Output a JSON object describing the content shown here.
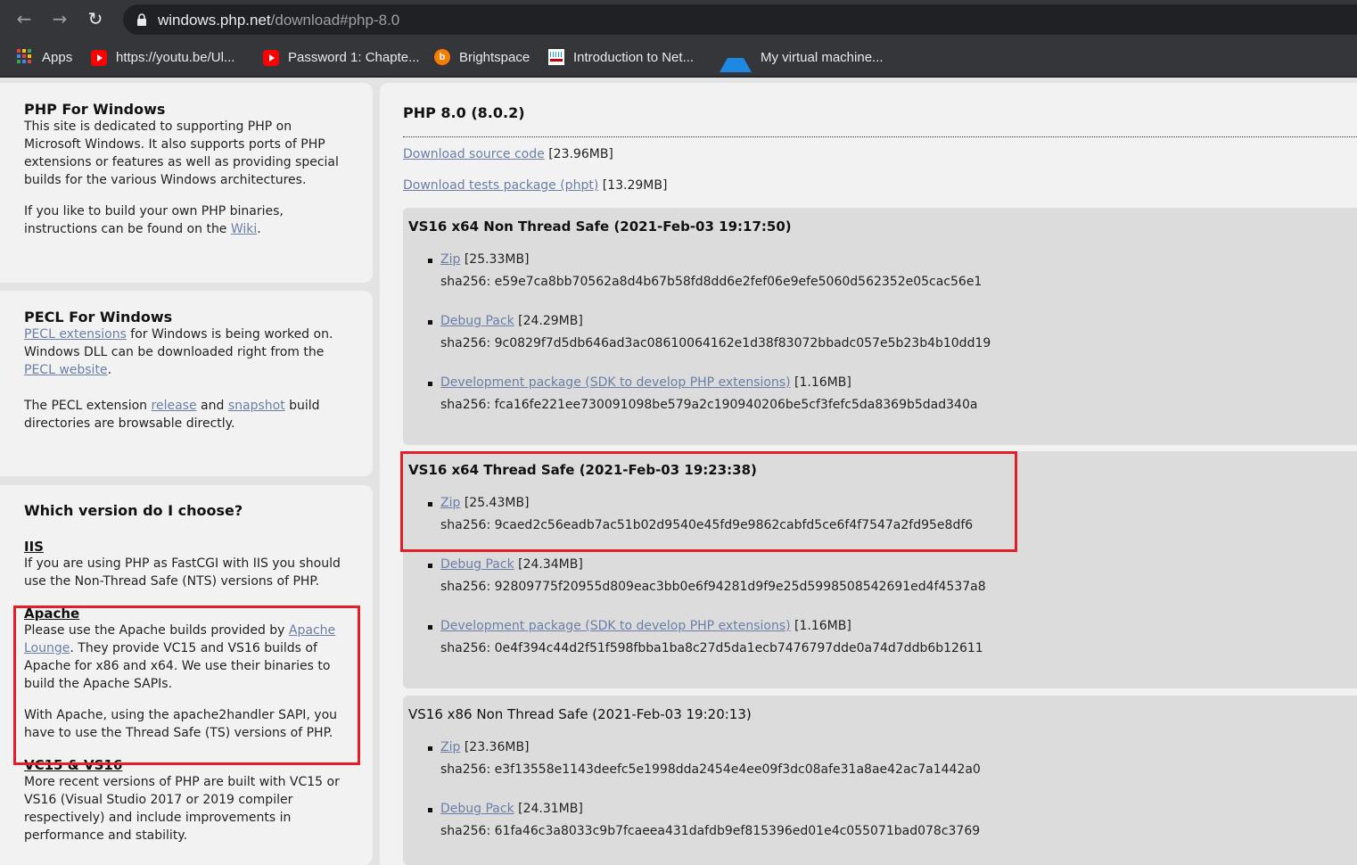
{
  "browser": {
    "url_host": "windows.php.net",
    "url_path": "/download#php-8.0",
    "bookmarks": [
      {
        "label": "Apps",
        "icon": "apps-grid-icon"
      },
      {
        "label": "https://youtu.be/Ul...",
        "icon": "youtube-icon"
      },
      {
        "label": "Password 1: Chapte...",
        "icon": "youtube-icon"
      },
      {
        "label": "Brightspace",
        "icon": "brightspace-icon"
      },
      {
        "label": "Introduction to Net...",
        "icon": "cisco-icon"
      },
      {
        "label": "My virtual machine...",
        "icon": "azure-icon"
      }
    ]
  },
  "sidebar": {
    "php_windows": {
      "title": "PHP For Windows",
      "p1": "This site is dedicated to supporting PHP on Microsoft Windows. It also supports ports of PHP extensions or features as well as providing special builds for the various Windows architectures.",
      "p2_before": "If you like to build your own PHP binaries, instructions can be found on the ",
      "p2_link": "Wiki",
      "p2_after": "."
    },
    "pecl": {
      "title": "PECL For Windows",
      "link1": "PECL extensions",
      "text1": " for Windows is being worked on. Windows DLL can be downloaded right from the ",
      "link2": "PECL website",
      "text2": ".",
      "p2_before": "The PECL extension ",
      "p2_link1": "release",
      "p2_mid": " and ",
      "p2_link2": "snapshot",
      "p2_after": " build directories are browsable directly."
    },
    "which": {
      "title": "Which version do I choose?",
      "iis_title": "IIS",
      "iis_text": "If you are using PHP as FastCGI with IIS you should use the Non-Thread Safe (NTS) versions of PHP.",
      "apache_title": "Apache",
      "apache_before": "Please use the Apache builds provided by ",
      "apache_link": "Apache Lounge",
      "apache_after": ". They provide VC15 and VS16 builds of Apache for x86 and x64. We use their binaries to build the Apache SAPIs.",
      "apache_p2": "With Apache, using the apache2handler SAPI, you have to use the Thread Safe (TS) versions of PHP.",
      "vc_title": "VC15 & VS16",
      "vc_text": "More recent versions of PHP are built with VC15 or VS16 (Visual Studio 2017 or 2019 compiler respectively) and include improvements in performance and stability."
    }
  },
  "main": {
    "title": "PHP 8.0 (8.0.2)",
    "source_link": "Download source code",
    "source_size": " [23.96MB]",
    "tests_link": "Download tests package (phpt)",
    "tests_size": " [13.29MB]",
    "builds": [
      {
        "title": "VS16 x64 Non Thread Safe (2021-Feb-03 19:17:50)",
        "items": [
          {
            "link": "Zip",
            "size": " [25.33MB]",
            "sha": "sha256: e59e7ca8bb70562a8d4b67b58fd8dd6e2fef06e9efe5060d562352e05cac56e1"
          },
          {
            "link": "Debug Pack",
            "size": " [24.29MB]",
            "sha": "sha256: 9c0829f7d5db646ad3ac08610064162e1d38f83072bbadc057e5b23b4b10dd19"
          },
          {
            "link": "Development package (SDK to develop PHP extensions)",
            "size": " [1.16MB]",
            "sha": "sha256: fca16fe221ee730091098be579a2c190940206be5cf3fefc5da8369b5dad340a"
          }
        ]
      },
      {
        "title": "VS16 x64 Thread Safe (2021-Feb-03 19:23:38)",
        "items": [
          {
            "link": "Zip",
            "size": " [25.43MB]",
            "sha": "sha256: 9caed2c56eadb7ac51b02d9540e45fd9e9862cabfd5ce6f4f7547a2fd95e8df6"
          },
          {
            "link": "Debug Pack",
            "size": " [24.34MB]",
            "sha": "sha256: 92809775f20955d809eac3bb0e6f94281d9f9e25d5998508542691ed4f4537a8"
          },
          {
            "link": "Development package (SDK to develop PHP extensions)",
            "size": " [1.16MB]",
            "sha": "sha256: 0e4f394c44d2f51f598fbba1ba8c27d5da1ecb7476797dde0a74d7ddb6b12611"
          }
        ]
      },
      {
        "title": "VS16 x86 Non Thread Safe (2021-Feb-03 19:20:13)",
        "items": [
          {
            "link": "Zip",
            "size": " [23.36MB]",
            "sha": "sha256: e3f13558e1143deefc5e1998dda2454e4ee09f3dc08afe31a8ae42ac7a1442a0"
          },
          {
            "link": "Debug Pack",
            "size": " [24.31MB]",
            "sha": "sha256: 61fa46c3a8033c9b7fcaeea431dafdb9ef815396ed01e4c055071bad078c3769"
          }
        ]
      }
    ]
  },
  "colors": {
    "highlight": "#e31e2a",
    "link": "#6b7ea6",
    "chrome": "#35363a"
  }
}
